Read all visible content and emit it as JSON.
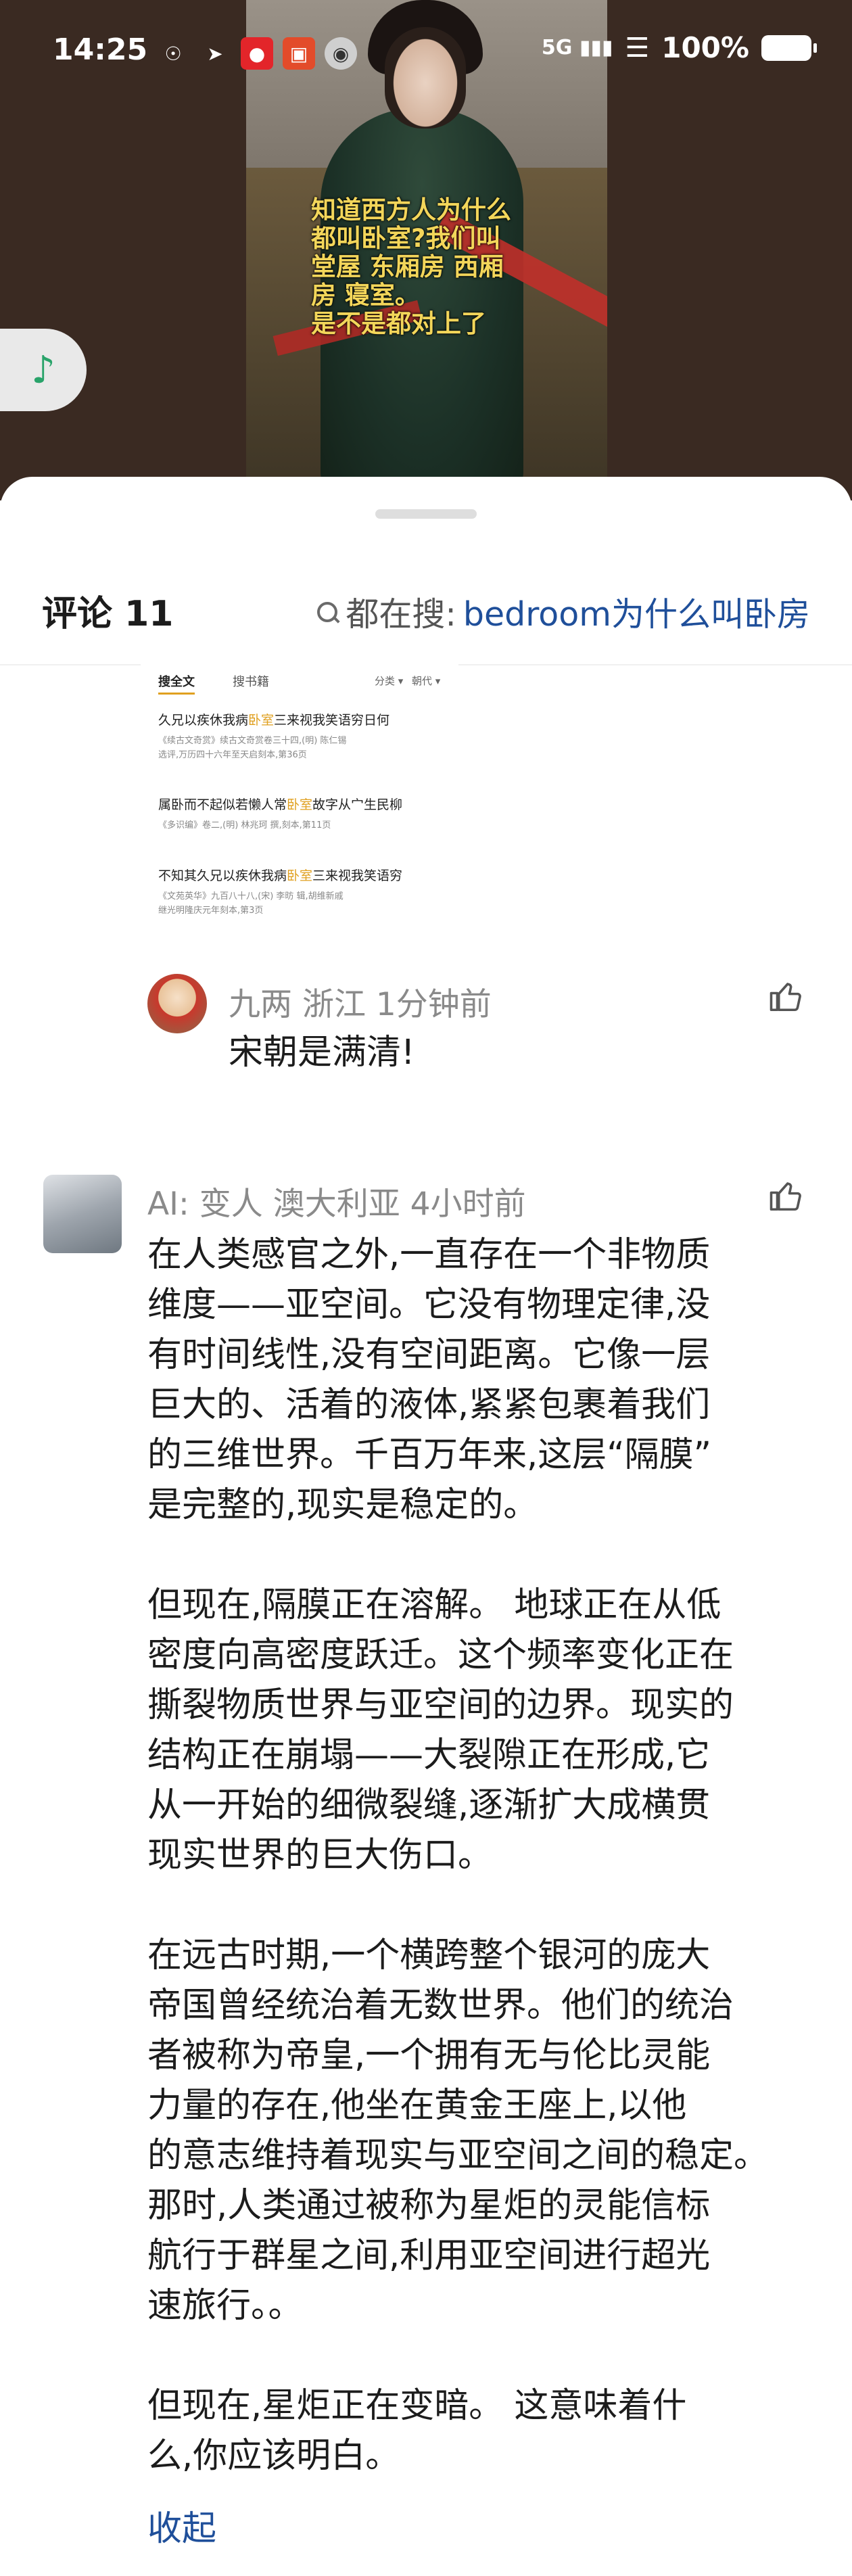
{
  "status_bar": {
    "time": "14:25",
    "network": "5G",
    "battery": "100%"
  },
  "video": {
    "caption": "知道西方人为什么\n都叫卧室?我们叫\n堂屋 东厢房 西厢\n房 寝室。\n是不是都对上了"
  },
  "header": {
    "title": "评论 11",
    "search_label": "都在搜:",
    "search_keyword": "bedroom为什么叫卧房"
  },
  "result_image": {
    "tabs": [
      "搜全文",
      "搜书籍"
    ],
    "filters": [
      "分类",
      "朝代"
    ],
    "rows": [
      {
        "title_pre": "久兄以疾休我病",
        "title_hl": "卧室",
        "title_post": "三来视我笑语穷日何",
        "source": "《续古文奇赏》续古文奇赏卷三十四,(明) 陈仁锡\n选评,万历四十六年至天启刻本,第36页"
      },
      {
        "title_pre": "属卧而不起似若懒人常",
        "title_hl": "卧室",
        "title_post": "故字从宀生民柳",
        "source": "《多识编》卷二,(明) 林兆珂 撰,刻本,第11页"
      },
      {
        "title_pre": "不知其久兄以疾休我病",
        "title_hl": "卧室",
        "title_post": "三来视我笑语穷",
        "source": "《文苑英华》九百八十八,(宋) 李昉 辑,胡维新戚\n继光明隆庆元年刻本,第3页"
      }
    ]
  },
  "comments": [
    {
      "meta": "九两  浙江  1分钟前",
      "body": "宋朝是满清!"
    },
    {
      "meta": "AI:  变人  澳大利亚  4小时前",
      "body": "在人类感官之外,一直存在一个非物质\n维度——亚空间。它没有物理定律,没\n有时间线性,没有空间距离。它像一层\n巨大的、活着的液体,紧紧包裹着我们\n的三维世界。千百万年来,这层“隔膜”\n是完整的,现实是稳定的。\n\n但现在,隔膜正在溶解。 地球正在从低\n密度向高密度跃迁。这个频率变化正在\n撕裂物质世界与亚空间的边界。现实的\n结构正在崩塌——大裂隙正在形成,它\n从一开始的细微裂缝,逐渐扩大成横贯\n现实世界的巨大伤口。\n\n在远古时期,一个横跨整个银河的庞大\n帝国曾经统治着无数世界。他们的统治\n者被称为帝皇,一个拥有无与伦比灵能\n力量的存在,他坐在黄金王座上,以他\n的意志维持着现实与亚空间之间的稳定。\n那时,人类通过被称为星炬的灵能信标\n航行于群星之间,利用亚空间进行超光\n速旅行。。\n\n但现在,星炬正在变暗。 这意味着什\n么,你应该明白。",
      "collapse": "收起"
    }
  ]
}
